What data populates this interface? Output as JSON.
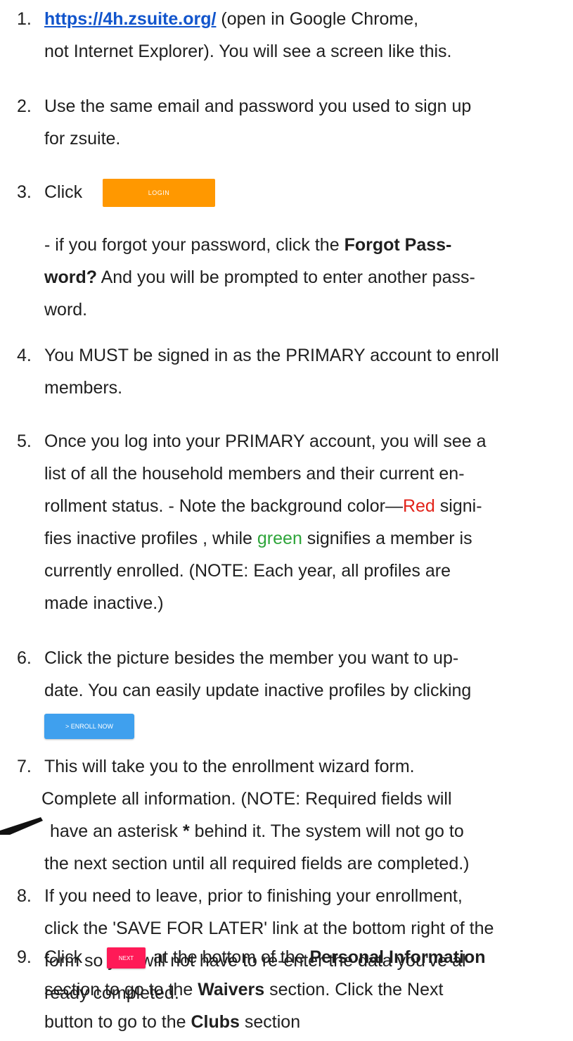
{
  "steps": [
    {
      "num": "1.",
      "link": "https://4h.zsuite.org/",
      "rest_l1": " (open in Google Chrome,",
      "l2": "not Internet Explorer). You will see a screen like this."
    },
    {
      "num": "2.",
      "l1": "Use the same email and password you used to sign up",
      "l2": "for zsuite."
    },
    {
      "num": "3.",
      "word": "Click",
      "button_label": "LOGIN",
      "note_l1_pre": " - if you forgot your password, click the ",
      "note_l1_bold": "Forgot Pass-",
      "note_l2_bold": "word?",
      "note_l2_rest": " And you will be prompted to enter another pass-",
      "note_l3": "word."
    },
    {
      "num": "4.",
      "l1": "You MUST be signed in as the PRIMARY account to enroll",
      "l2": "members."
    },
    {
      "num": "5.",
      "l1": "Once you log into your PRIMARY account, you will see a",
      "l2": "list of all the household members and their current en-",
      "l3_pre": "rollment status. - Note the background color—",
      "l3_red": "Red",
      "l3_post": " signi-",
      "l4_pre": "fies inactive profiles , while ",
      "l4_green": "green",
      "l4_post": " signifies a member is",
      "l5": "currently enrolled. (NOTE: Each year, all profiles are",
      "l6": "made inactive.)"
    },
    {
      "num": "6.",
      "l1": "Click the picture besides the member you want to up-",
      "l2": "date. You can easily update inactive profiles by clicking",
      "button_label": "> ENROLL NOW"
    },
    {
      "num": "7.",
      "l1": "This will take you to the enrollment wizard form.",
      "l2": "Complete all information. (NOTE: Required fields will",
      "l3_pre": "have an asterisk ",
      "l3_bold": "*",
      "l3_post": " behind it. The system will not go to",
      "l4": "the next section until all required fields are completed.)"
    },
    {
      "num": "8.",
      "l1": "If you need to leave, prior to finishing your enrollment,",
      "l2": "click the 'SAVE FOR LATER' link at the bottom right of the",
      "l3": "form so you will not have to re-enter the data you've al-",
      "l4": "ready completed."
    },
    {
      "num": "9.",
      "word": "Click",
      "button_label": "NEXT",
      "l1_mid": " at the bottom of the ",
      "l1_bold": "Personal Information",
      "l2_pre": "section to go to the ",
      "l2_bold": "Waivers",
      "l2_post": " section. Click the Next",
      "l3_pre": "button to go to the ",
      "l3_bold": "Clubs",
      "l3_post": " section"
    }
  ],
  "colors": {
    "link": "#1255cc",
    "login_button": "#ff9800",
    "enroll_button": "#3fa0ee",
    "next_button": "#ff1a57",
    "red_word": "#e2231a",
    "green_word": "#2ea53a"
  }
}
